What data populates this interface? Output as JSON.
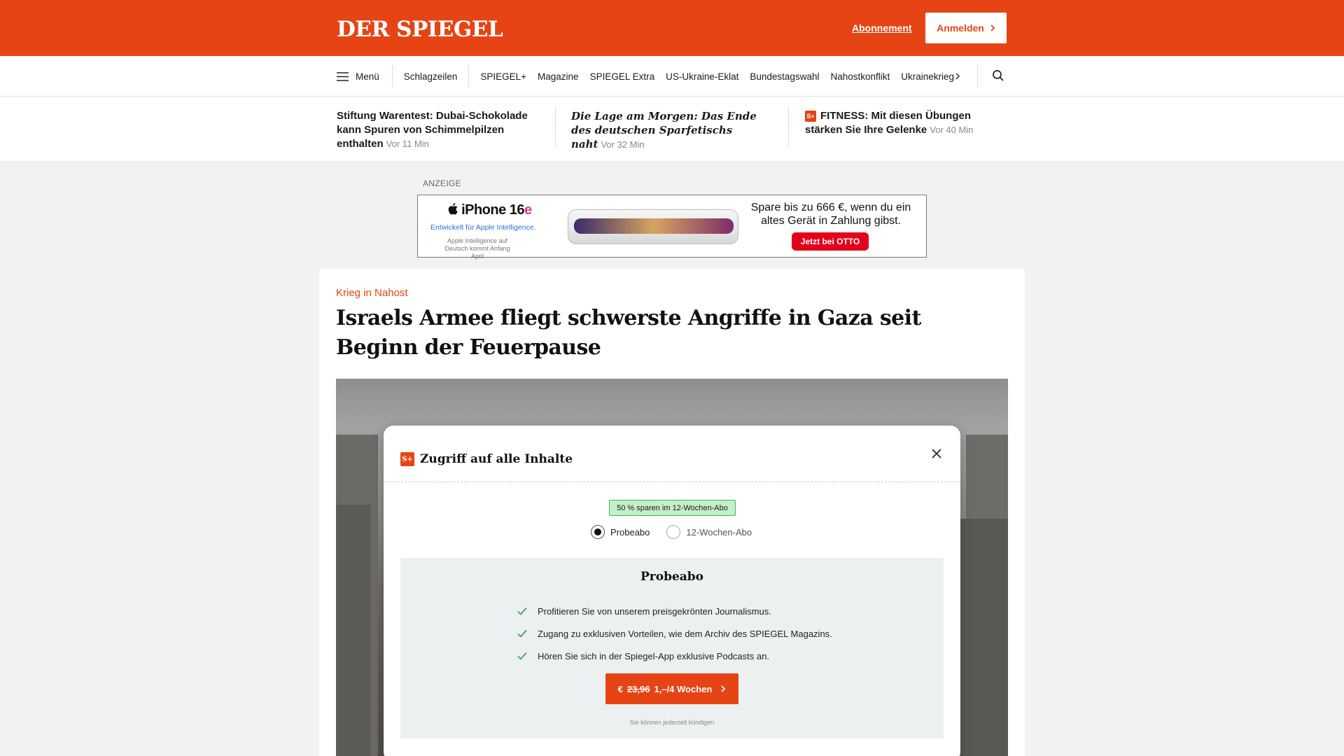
{
  "header": {
    "logo": "DER SPIEGEL",
    "subscription_link": "Abonnement",
    "login_button": "Anmelden",
    "brand_color": "#e64415"
  },
  "nav": {
    "menu_label": "Menü",
    "items": [
      "Schlagzeilen",
      "SPIEGEL+",
      "Magazine",
      "SPIEGEL Extra",
      "US-Ukraine-Eklat",
      "Bundestagswahl",
      "Nahostkonflikt",
      "Ukrainekrieg"
    ],
    "more_icon": "chevron-right-icon",
    "search_icon": "search-icon"
  },
  "teasers": [
    {
      "title": "Stiftung Warentest: Dubai-Schokolade kann Spuren von Schimmelpilzen enthalten",
      "time": "Vor 11 Min"
    },
    {
      "title": "Die Lage am Morgen: Das Ende des deutschen Sparfetischs naht",
      "time": "Vor 32 Min"
    },
    {
      "badge": "S+",
      "title": "FITNESS: Mit diesen Übungen stärken Sie Ihre Gelenke",
      "time": "Vor 40 Min"
    }
  ],
  "ad": {
    "label": "ANZEIGE",
    "product": "iPhone 16",
    "product_suffix": "e",
    "tagline": "Entwickelt für Apple Intelligence.",
    "note": "Apple Intelligence auf Deutsch kommt Anfang April",
    "offer": "Spare bis zu 666 €, wenn du ein altes Gerät in Zahlung gibst.",
    "cta": "Jetzt bei OTTO"
  },
  "article": {
    "kicker": "Krieg in Nahost",
    "headline": "Israels Armee fliegt schwerste Angriffe in Gaza seit Beginn der Feuerpause"
  },
  "paywall": {
    "badge": "S+",
    "title": "Zugriff auf alle Inhalte",
    "save_badge": "50 % sparen im 12-Wochen-Abo",
    "options": [
      {
        "label": "Probeabo",
        "selected": true
      },
      {
        "label": "12-Wochen-Abo",
        "selected": false
      }
    ],
    "plan_title": "Probeabo",
    "benefits": [
      "Profitieren Sie von unserem preisgekrönten Journalismus.",
      "Zugang zu exklusiven Vorteilen, wie dem Archiv des SPIEGEL Magazins.",
      "Hören Sie sich in der Spiegel-App exklusive Podcasts an."
    ],
    "cta_currency": "€",
    "cta_old_price": "23,96",
    "cta_new_price": "1,–/4 Wochen",
    "cancel_note": "Sie können jederzeit kündigen"
  }
}
